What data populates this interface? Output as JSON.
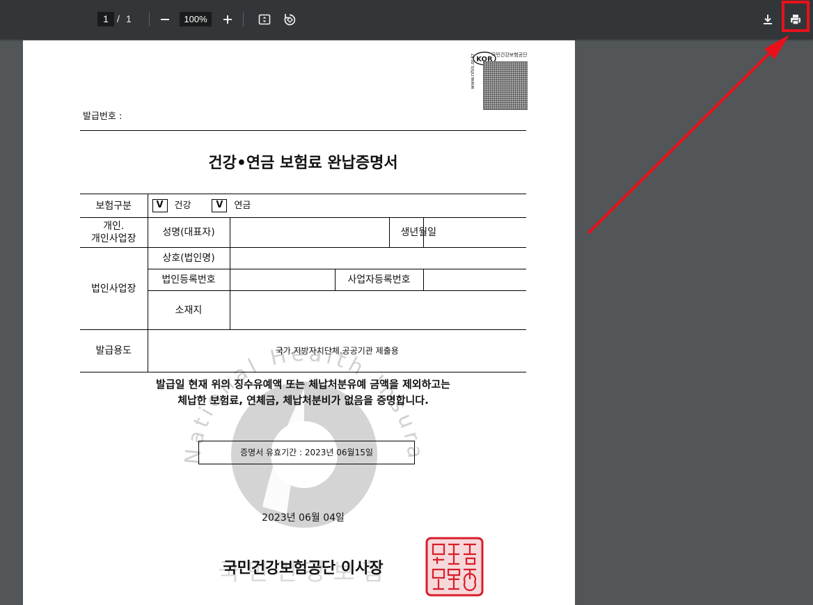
{
  "toolbar": {
    "current_page": "1",
    "separator": "/",
    "total_pages": "1",
    "zoom": "100%"
  },
  "document": {
    "logo_text": "KOR",
    "url_text": "www.nhis.or.kr",
    "agency_small": "국민건강보험공단",
    "issue_no_label": "발급번호 :",
    "title": "건강•연금 보험료 완납증명서",
    "table": {
      "insurance_type_label": "보험구분",
      "check_mark": "V",
      "health_label": "건강",
      "pension_label": "연금",
      "individual_label_1": "개인.",
      "individual_label_2": "개인사업장",
      "name_label": "성명(대표자)",
      "birth_label": "생년월일",
      "corporate_label": "법인사업장",
      "company_label": "상호(법인명)",
      "corp_reg_label": "법인등록번호",
      "biz_reg_label": "사업자등록번호",
      "address_label": "소재지",
      "purpose_label": "발급용도",
      "purpose_value": "국가.지방자치단체.공공기관 제출용"
    },
    "statement_line1": "발급일 현재 위의 징수유예액 또는 체납처분유예 금액을 제외하고는",
    "statement_line2": "체납한 보험료, 연체금, 체납처분비가 없음을 증명합니다.",
    "validity": "증명서 유효기간 : 2023년 06월15일",
    "issue_date": "2023년 06월 04일",
    "issuer": "국민건강보험공단 이사장",
    "watermark_text": "National Health Insurance Service",
    "watermark_korean": "국민건강보험",
    "seal_text": "국민건강보험공단이사장인"
  },
  "colors": {
    "toolbar_bg": "#323639",
    "viewer_bg": "#525659",
    "annotation_red": "#e8111a",
    "seal_red": "#d81e2a"
  },
  "icons": [
    "zoom-out-icon",
    "zoom-in-icon",
    "fit-page-icon",
    "rotate-icon",
    "download-icon",
    "print-icon"
  ]
}
